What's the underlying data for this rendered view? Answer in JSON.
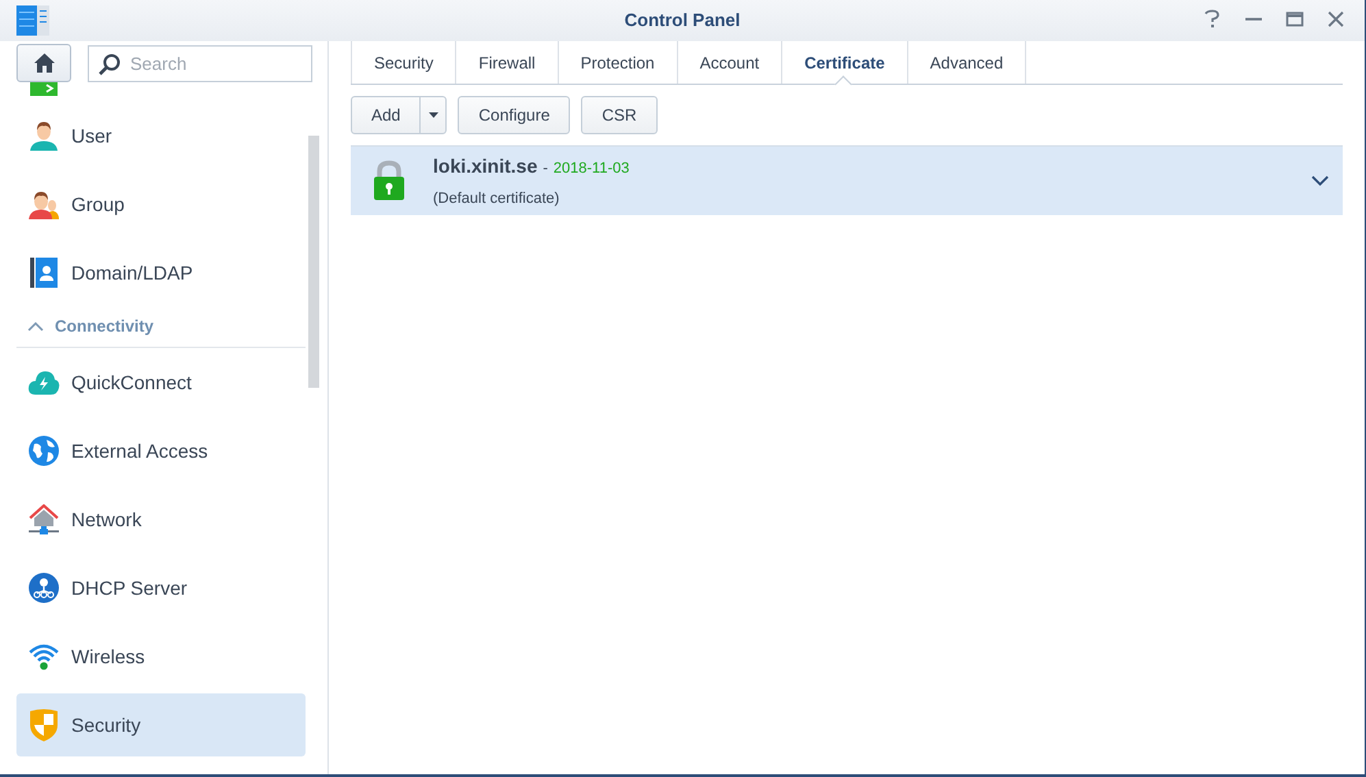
{
  "window": {
    "title": "Control Panel"
  },
  "search": {
    "placeholder": "Search"
  },
  "sidebar": {
    "items": [
      {
        "kind": "item",
        "label": "User",
        "selected": false
      },
      {
        "kind": "item",
        "label": "Group",
        "selected": false
      },
      {
        "kind": "item",
        "label": "Domain/LDAP",
        "selected": false
      },
      {
        "kind": "section",
        "label": "Connectivity",
        "expanded": true
      },
      {
        "kind": "item",
        "label": "QuickConnect",
        "selected": false
      },
      {
        "kind": "item",
        "label": "External Access",
        "selected": false
      },
      {
        "kind": "item",
        "label": "Network",
        "selected": false
      },
      {
        "kind": "item",
        "label": "DHCP Server",
        "selected": false
      },
      {
        "kind": "item",
        "label": "Wireless",
        "selected": false
      },
      {
        "kind": "item",
        "label": "Security",
        "selected": true
      }
    ]
  },
  "tabs": [
    {
      "label": "Security",
      "selected": false
    },
    {
      "label": "Firewall",
      "selected": false
    },
    {
      "label": "Protection",
      "selected": false
    },
    {
      "label": "Account",
      "selected": false
    },
    {
      "label": "Certificate",
      "selected": true
    },
    {
      "label": "Advanced",
      "selected": false
    }
  ],
  "toolbar": {
    "buttons": [
      {
        "kind": "split",
        "label": "Add"
      },
      {
        "kind": "plain",
        "label": "Configure"
      },
      {
        "kind": "plain",
        "label": "CSR"
      }
    ]
  },
  "certificates": [
    {
      "name": "loki.xinit.se",
      "separator": "-",
      "date": "2018-11-03",
      "note": "(Default certificate)",
      "selected": true
    }
  ]
}
